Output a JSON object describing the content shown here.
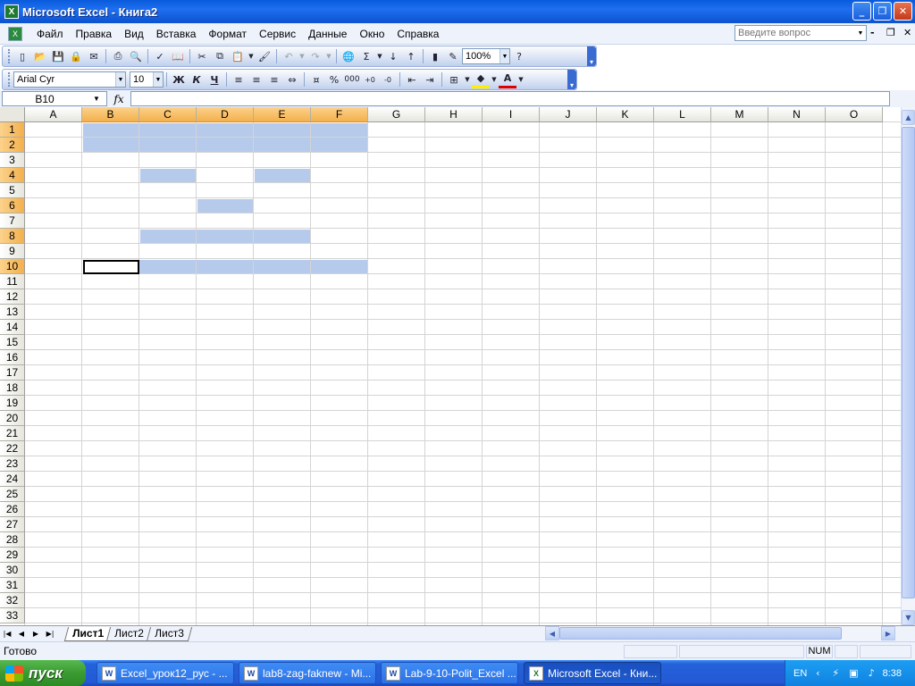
{
  "window": {
    "title": "Microsoft Excel - Книга2"
  },
  "menu": {
    "items": [
      "Файл",
      "Правка",
      "Вид",
      "Вставка",
      "Формат",
      "Сервис",
      "Данные",
      "Окно",
      "Справка"
    ]
  },
  "help": {
    "placeholder": "Введите вопрос"
  },
  "toolbar": {
    "zoom": "100%",
    "font": "Arial Cyr",
    "font_size": "10",
    "bold": "Ж",
    "italic": "К",
    "underline": "Ч"
  },
  "formula_bar": {
    "name_box": "B10",
    "fx": "fx",
    "formula": ""
  },
  "grid": {
    "columns": [
      "A",
      "B",
      "C",
      "D",
      "E",
      "F",
      "G",
      "H",
      "I",
      "J",
      "K",
      "L",
      "M",
      "N",
      "O"
    ],
    "rows": [
      "1",
      "2",
      "3",
      "4",
      "5",
      "6",
      "7",
      "8",
      "9",
      "10",
      "11",
      "12",
      "13",
      "14",
      "15",
      "16",
      "17",
      "18",
      "19",
      "20",
      "21",
      "22",
      "23",
      "24",
      "25",
      "26",
      "27",
      "28",
      "29",
      "30",
      "31",
      "32",
      "33"
    ],
    "selected_columns": [
      "B",
      "C",
      "D",
      "E",
      "F"
    ],
    "selected_rows": [
      "1",
      "2",
      "4",
      "6",
      "8",
      "10"
    ],
    "active_cell": "B10",
    "highlight_color": "#b6caeb",
    "selected_ranges": [
      "B1:F2",
      "C4",
      "E4",
      "D6",
      "C8:E8",
      "B10:F10"
    ]
  },
  "sheets": {
    "tabs": [
      "Лист1",
      "Лист2",
      "Лист3"
    ],
    "active": "Лист1"
  },
  "status": {
    "text": "Готово",
    "num": "NUM"
  },
  "taskbar": {
    "start": "пуск",
    "tasks": [
      "Excel_урок12_рус - ...",
      "lab8-zag-faknew - Mi...",
      "Lab-9-10-Polit_Excel ...",
      "Microsoft Excel - Кни..."
    ],
    "lang": "EN",
    "clock": "8:38"
  }
}
